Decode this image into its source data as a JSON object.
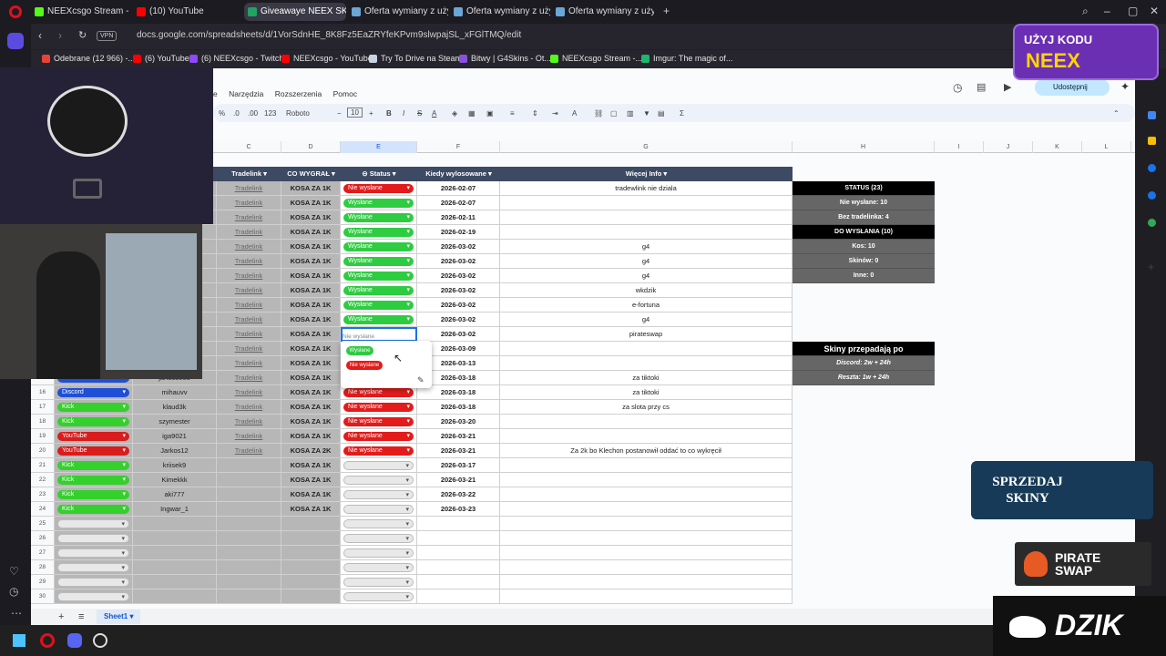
{
  "tabs": [
    {
      "label": "NEEXcsgo Stream - Watch",
      "color": "#53fc18"
    },
    {
      "label": "(10) YouTube",
      "color": "#ff0000"
    },
    {
      "label": "Giveawaye NEEX SKINY -",
      "color": "#1fa463"
    },
    {
      "label": "Oferta wymiany z użytkow",
      "color": "#1b2838"
    },
    {
      "label": "Oferta wymiany z użytkow",
      "color": "#1b2838"
    },
    {
      "label": "Oferta wymiany z użytkow",
      "color": "#1b2838"
    }
  ],
  "browser": {
    "url": "docs.google.com/spreadsheets/d/1VorSdnHE_8K8Fz5EaZRYfeKPvm9slwpajSL_xFGlTMQ/edit",
    "vpn": "VPN"
  },
  "bookmarks": [
    "Odebrane (12 966) -...",
    "(6) YouTube",
    "(6) NEEXcsgo - Twitch",
    "NEEXcsgo - YouTube",
    "Try To Drive na Steam",
    "Bitwy | G4Skins - Ot...",
    "NEEXcsgo Stream -...",
    "Imgur: The magic of..."
  ],
  "menu": [
    "e",
    "Narzędzia",
    "Rozszerzenia",
    "Pomoc"
  ],
  "toolbar": {
    "percent": "%",
    "dec1": ".0",
    "dec2": ".00",
    "num": "123",
    "font": "Roboto",
    "size": "10",
    "share": "Udostępnij"
  },
  "columns": [
    "C",
    "D",
    "E",
    "F",
    "G",
    "H",
    "I",
    "J",
    "K",
    "L"
  ],
  "headers": {
    "tradelink": "Tradelink",
    "co": "CO WYGRAŁ",
    "status": "Status",
    "kiedy": "Kiedy wylosowane",
    "wiecej": "Więcej Info"
  },
  "rows": [
    {
      "n": "2",
      "src": "",
      "nick": "",
      "link": "Tradelink",
      "prize": "KOSA ZA 1K",
      "status": "Nie wysłane",
      "date": "2026-02-07",
      "info": "tradewlink nie dziala"
    },
    {
      "n": "3",
      "src": "",
      "nick": "",
      "link": "Tradelink",
      "prize": "KOSA ZA 1K",
      "status": "Wysłane",
      "date": "2026-02-07",
      "info": ""
    },
    {
      "n": "4",
      "src": "",
      "nick": "",
      "link": "Tradelink",
      "prize": "KOSA ZA 1K",
      "status": "Wysłane",
      "date": "2026-02-11",
      "info": ""
    },
    {
      "n": "5",
      "src": "",
      "nick": "",
      "link": "Tradelink",
      "prize": "KOSA ZA 1K",
      "status": "Wysłane",
      "date": "2026-02-19",
      "info": ""
    },
    {
      "n": "6",
      "src": "",
      "nick": "",
      "link": "Tradelink",
      "prize": "KOSA ZA 1K",
      "status": "Wysłane",
      "date": "2026-03-02",
      "info": "g4"
    },
    {
      "n": "7",
      "src": "",
      "nick": "",
      "link": "Tradelink",
      "prize": "KOSA ZA 1K",
      "status": "Wysłane",
      "date": "2026-03-02",
      "info": "g4"
    },
    {
      "n": "8",
      "src": "",
      "nick": "",
      "link": "Tradelink",
      "prize": "KOSA ZA 1K",
      "status": "Wysłane",
      "date": "2026-03-02",
      "info": "g4"
    },
    {
      "n": "9",
      "src": "",
      "nick": "",
      "link": "Tradelink",
      "prize": "KOSA ZA 1K",
      "status": "Wysłane",
      "date": "2026-03-02",
      "info": "wkdzik"
    },
    {
      "n": "10",
      "src": "",
      "nick": "",
      "link": "Tradelink",
      "prize": "KOSA ZA 1K",
      "status": "Wysłane",
      "date": "2026-03-02",
      "info": "e-fortuna"
    },
    {
      "n": "11",
      "src": "",
      "nick": "",
      "link": "Tradelink",
      "prize": "KOSA ZA 1K",
      "status": "Wysłane",
      "date": "2026-03-02",
      "info": "g4"
    },
    {
      "n": "12",
      "src": "",
      "nick": "",
      "link": "Tradelink",
      "prize": "KOSA ZA 1K",
      "status": "editing",
      "date": "2026-03-02",
      "info": "pirateswap"
    },
    {
      "n": "13",
      "src": "",
      "nick": "",
      "link": "Tradelink",
      "prize": "KOSA ZA 1K",
      "status": "hidden",
      "date": "2026-03-09",
      "info": ""
    },
    {
      "n": "14",
      "src": "",
      "nick": "",
      "link": "Tradelink",
      "prize": "KOSA ZA 1K",
      "status": "hidden",
      "date": "2026-03-13",
      "info": ""
    },
    {
      "n": "15",
      "src": "Discord",
      "nick": "janos8085",
      "link": "Tradelink",
      "prize": "KOSA ZA 1K",
      "status": "hidden",
      "date": "2026-03-18",
      "info": "za tiktoki"
    },
    {
      "n": "16",
      "src": "Discord",
      "nick": "mihauvv",
      "link": "Tradelink",
      "prize": "KOSA ZA 1K",
      "status": "Nie wysłane",
      "date": "2026-03-18",
      "info": "za tiktoki"
    },
    {
      "n": "17",
      "src": "Kick",
      "nick": "klaud3k",
      "link": "Tradelink",
      "prize": "KOSA ZA 1K",
      "status": "Nie wysłane",
      "date": "2026-03-18",
      "info": "za slota przy cs"
    },
    {
      "n": "18",
      "src": "Kick",
      "nick": "szymester",
      "link": "Tradelink",
      "prize": "KOSA ZA 1K",
      "status": "Nie wysłane",
      "date": "2026-03-20",
      "info": ""
    },
    {
      "n": "19",
      "src": "YouTube",
      "nick": "iga9021",
      "link": "Tradelink",
      "prize": "KOSA ZA 1K",
      "status": "Nie wysłane",
      "date": "2026-03-21",
      "info": ""
    },
    {
      "n": "20",
      "src": "YouTube",
      "nick": "Jarkos12",
      "link": "Tradelink",
      "prize": "KOSA ZA 2K",
      "status": "Nie wysłane",
      "date": "2026-03-21",
      "info": "Za 2k bo Klechon postanowił oddać to co wykręcił"
    },
    {
      "n": "21",
      "src": "Kick",
      "nick": "kriisek9",
      "link": "",
      "prize": "KOSA ZA 1K",
      "status": "",
      "date": "2026-03-17",
      "info": ""
    },
    {
      "n": "22",
      "src": "Kick",
      "nick": "Kimekkk",
      "link": "",
      "prize": "KOSA ZA 1K",
      "status": "",
      "date": "2026-03-21",
      "info": ""
    },
    {
      "n": "23",
      "src": "Kick",
      "nick": "aki777",
      "link": "",
      "prize": "KOSA ZA 1K",
      "status": "",
      "date": "2026-03-22",
      "info": ""
    },
    {
      "n": "24",
      "src": "Kick",
      "nick": "Ingwar_1",
      "link": "",
      "prize": "KOSA ZA 1K",
      "status": "",
      "date": "2026-03-23",
      "info": ""
    },
    {
      "n": "25",
      "src": "",
      "nick": "",
      "link": "",
      "prize": "",
      "status": "",
      "date": "",
      "info": ""
    },
    {
      "n": "26",
      "src": "",
      "nick": "",
      "link": "",
      "prize": "",
      "status": "",
      "date": "",
      "info": ""
    },
    {
      "n": "27",
      "src": "",
      "nick": "",
      "link": "",
      "prize": "",
      "status": "",
      "date": "",
      "info": ""
    },
    {
      "n": "28",
      "src": "",
      "nick": "",
      "link": "",
      "prize": "",
      "status": "",
      "date": "",
      "info": ""
    },
    {
      "n": "29",
      "src": "",
      "nick": "",
      "link": "",
      "prize": "",
      "status": "",
      "date": "",
      "info": ""
    },
    {
      "n": "30",
      "src": "",
      "nick": "",
      "link": "",
      "prize": "",
      "status": "",
      "date": "",
      "info": ""
    }
  ],
  "editing_value": "Nie wysłane",
  "dropdown": {
    "opt1": "Wysłane",
    "opt2": "Nie wysłane"
  },
  "stats": {
    "status": "STATUS (23)",
    "nie": "Nie wysłane: 10",
    "bez": "Bez tradelinka: 4",
    "do": "DO WYSŁANIA (10)",
    "kos": "Kos: 10",
    "skinow": "Skinów: 0",
    "inne": "Inne: 0",
    "skiny": "Skiny przepadają po",
    "discord": "Discord: 2w + 24h",
    "reszta": "Reszta: 1w + 24h"
  },
  "sheet_tab": "Sheet1",
  "overlays": {
    "neex_top": "UŻYJ KODU",
    "neex_bottom": "NEEX",
    "sprzedaj": "SPRZEDAJ SKINY",
    "pirate": "PIRATE SWAP",
    "dzik": "DZIK"
  },
  "colors": {
    "sent": "#2ecc40",
    "notsent": "#e31b1b",
    "discord": "#1f4fd8",
    "kick": "#34d02c",
    "youtube": "#d91c1c",
    "header": "#3d4a63"
  }
}
